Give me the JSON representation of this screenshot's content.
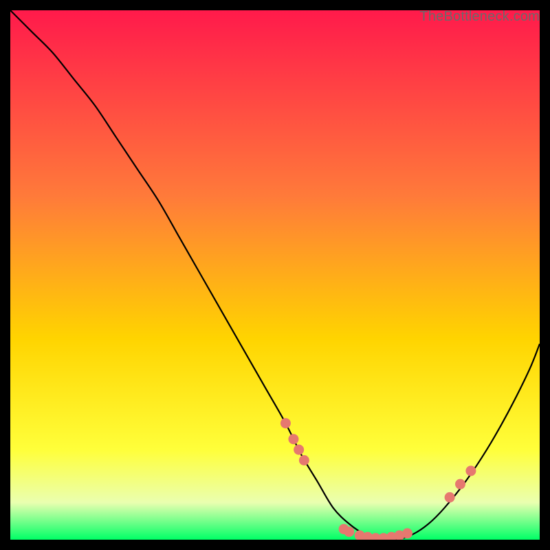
{
  "watermark": "TheBottleneck.com",
  "colors": {
    "gradient_top": "#ff1a4b",
    "gradient_mid1": "#ff7a3a",
    "gradient_mid2": "#ffd400",
    "gradient_mid3": "#ffff3a",
    "gradient_bottom_pale": "#eaffb0",
    "gradient_green": "#00ff66",
    "curve": "#000000",
    "dot": "#e6786f",
    "frame_bg": "#000000"
  },
  "chart_data": {
    "type": "line",
    "title": "",
    "xlabel": "",
    "ylabel": "",
    "xlim": [
      0,
      100
    ],
    "ylim": [
      0,
      100
    ],
    "curve": {
      "name": "bottleneck-curve",
      "x": [
        0,
        4,
        8,
        12,
        16,
        20,
        24,
        28,
        32,
        36,
        40,
        44,
        48,
        52,
        55,
        58,
        61,
        64,
        67,
        70,
        73,
        76,
        79,
        82,
        86,
        90,
        94,
        98,
        100
      ],
      "y": [
        100,
        96,
        92,
        87,
        82,
        76,
        70,
        64,
        57,
        50,
        43,
        36,
        29,
        22,
        16,
        11,
        6,
        3,
        1,
        0,
        0,
        1,
        3,
        6,
        11,
        17,
        24,
        32,
        37
      ]
    },
    "series": [
      {
        "name": "highlight-dots",
        "type": "scatter",
        "points": [
          {
            "x": 52.0,
            "y": 22.0
          },
          {
            "x": 53.5,
            "y": 19.0
          },
          {
            "x": 54.5,
            "y": 17.0
          },
          {
            "x": 55.5,
            "y": 15.0
          },
          {
            "x": 63.0,
            "y": 2.0
          },
          {
            "x": 64.0,
            "y": 1.5
          },
          {
            "x": 66.0,
            "y": 0.8
          },
          {
            "x": 67.5,
            "y": 0.5
          },
          {
            "x": 69.0,
            "y": 0.3
          },
          {
            "x": 70.5,
            "y": 0.3
          },
          {
            "x": 72.0,
            "y": 0.5
          },
          {
            "x": 73.5,
            "y": 0.8
          },
          {
            "x": 75.0,
            "y": 1.2
          },
          {
            "x": 83.0,
            "y": 8.0
          },
          {
            "x": 85.0,
            "y": 10.5
          },
          {
            "x": 87.0,
            "y": 13.0
          }
        ]
      }
    ]
  }
}
